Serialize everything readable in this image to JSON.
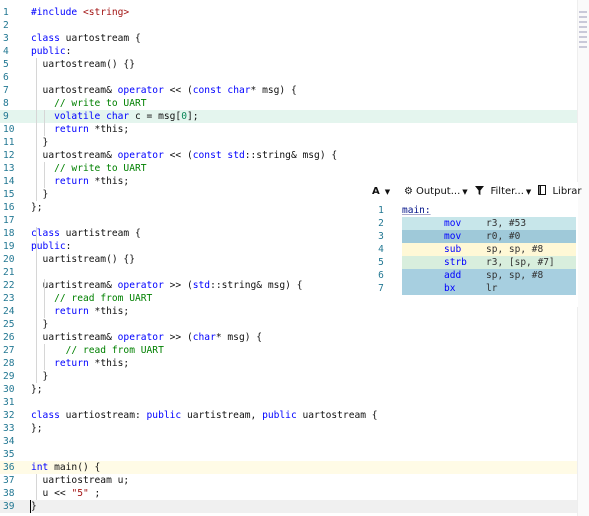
{
  "editor": {
    "lines": [
      {
        "n": "1",
        "code": "#include <string>"
      },
      {
        "n": "2",
        "code": ""
      },
      {
        "n": "3",
        "code": "class uartostream {"
      },
      {
        "n": "4",
        "code": "public:"
      },
      {
        "n": "5",
        "code": "  uartostream() {}"
      },
      {
        "n": "6",
        "code": ""
      },
      {
        "n": "7",
        "code": "  uartostream& operator << (const char* msg) {"
      },
      {
        "n": "8",
        "code": "    // write to UART"
      },
      {
        "n": "9",
        "code": "    volatile char c = msg[0];"
      },
      {
        "n": "10",
        "code": "    return *this;"
      },
      {
        "n": "11",
        "code": "  }"
      },
      {
        "n": "12",
        "code": "  uartostream& operator << (const std::string& msg) {"
      },
      {
        "n": "13",
        "code": "    // write to UART"
      },
      {
        "n": "14",
        "code": "    return *this;"
      },
      {
        "n": "15",
        "code": "  }"
      },
      {
        "n": "16",
        "code": "};"
      },
      {
        "n": "17",
        "code": ""
      },
      {
        "n": "18",
        "code": "class uartistream {"
      },
      {
        "n": "19",
        "code": "public:"
      },
      {
        "n": "20",
        "code": "  uartistream() {}"
      },
      {
        "n": "21",
        "code": ""
      },
      {
        "n": "22",
        "code": "  uartistream& operator >> (std::string& msg) {"
      },
      {
        "n": "23",
        "code": "    // read from UART"
      },
      {
        "n": "24",
        "code": "    return *this;"
      },
      {
        "n": "25",
        "code": "  }"
      },
      {
        "n": "26",
        "code": "  uartistream& operator >> (char* msg) {"
      },
      {
        "n": "27",
        "code": "      // read from UART"
      },
      {
        "n": "28",
        "code": "    return *this;"
      },
      {
        "n": "29",
        "code": "  }"
      },
      {
        "n": "30",
        "code": "};"
      },
      {
        "n": "31",
        "code": ""
      },
      {
        "n": "32",
        "code": "class uartiostream: public uartistream, public uartostream {"
      },
      {
        "n": "33",
        "code": "};"
      },
      {
        "n": "34",
        "code": ""
      },
      {
        "n": "35",
        "code": ""
      },
      {
        "n": "36",
        "code": "int main() {"
      },
      {
        "n": "37",
        "code": "  uartiostream u;"
      },
      {
        "n": "38",
        "code": "  u << \"5\" ;"
      },
      {
        "n": "39",
        "code": "}"
      }
    ]
  },
  "toolbar": {
    "font_label": "A",
    "output_label": "Output...",
    "filter_label": "Filter...",
    "libraries_label": "Librar"
  },
  "asm": {
    "lines": [
      {
        "n": "1",
        "label": "main:",
        "op": "",
        "args": ""
      },
      {
        "n": "2",
        "label": "",
        "op": "mov",
        "args": "r3, #53"
      },
      {
        "n": "3",
        "label": "",
        "op": "mov",
        "args": "r0, #0"
      },
      {
        "n": "4",
        "label": "",
        "op": "sub",
        "args": "sp, sp, #8"
      },
      {
        "n": "5",
        "label": "",
        "op": "strb",
        "args": "r3, [sp, #7]"
      },
      {
        "n": "6",
        "label": "",
        "op": "add",
        "args": "sp, sp, #8"
      },
      {
        "n": "7",
        "label": "",
        "op": "bx",
        "args": "lr"
      }
    ]
  },
  "colors": {
    "keyword": "#0000ff",
    "comment": "#008000",
    "string": "#a31515",
    "line_number": "#237893"
  }
}
